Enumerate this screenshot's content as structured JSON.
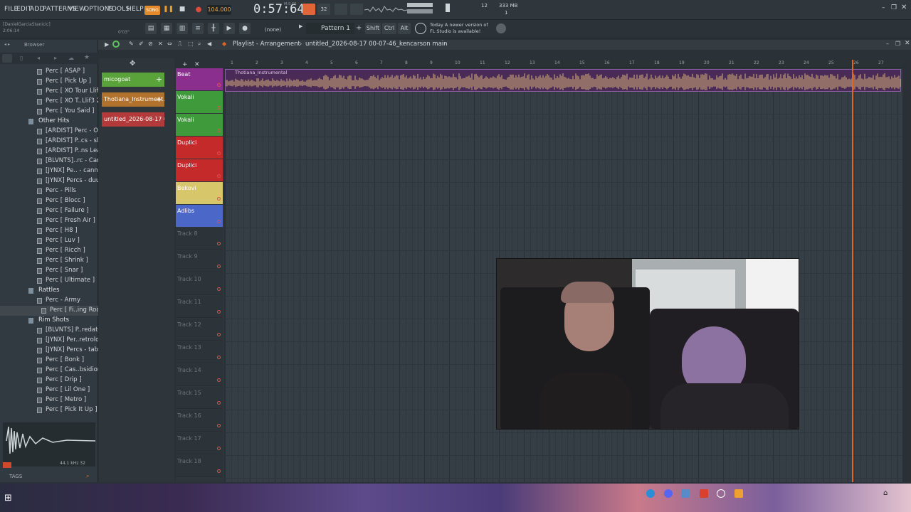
{
  "menu": [
    "FILE",
    "EDIT",
    "ADD",
    "PATTERNS",
    "VIEW",
    "OPTIONS",
    "TOOLS",
    "HELP"
  ],
  "transport": {
    "mode": "SONG",
    "tempo": "104.000",
    "time": "0:57:64",
    "time_label": "M:S:CS",
    "cpu": "12",
    "ram": "333 MB",
    "poly": "1"
  },
  "user": {
    "name": "[DanielGarciaStanicic]",
    "elapsed": "2:06:14",
    "hint": "0'03\""
  },
  "toolbar": {
    "snap": "(none)",
    "pattern": "Pattern 1",
    "shift": "Shift",
    "ctrl": "Ctrl",
    "alt": "Alt",
    "news_line1": "Today  A newer version of",
    "news_line2": "FL Studio is available!"
  },
  "browser": {
    "title": "Browser",
    "items": [
      {
        "label": "Perc [ ASAP ]",
        "folder": false
      },
      {
        "label": "Perc [ Pick Up ]",
        "folder": false
      },
      {
        "label": "Perc [ XO Tour Llif3 ]",
        "folder": false
      },
      {
        "label": "Perc [ XO T..Llif3 2 ]",
        "folder": false
      },
      {
        "label": "Perc [ You Said ]",
        "folder": false
      },
      {
        "label": "Other Hits",
        "folder": true
      },
      {
        "label": "[ARDIST] Perc - OV",
        "folder": false
      },
      {
        "label": "[ARDIST] P..cs - slatt",
        "folder": false
      },
      {
        "label": "[ARDIST] P..ns Lean",
        "folder": false
      },
      {
        "label": "[BLVNTS]..rc - Carti",
        "folder": false
      },
      {
        "label": "[JYNX] Pe.. - cannon",
        "folder": false
      },
      {
        "label": "[JYNX] Percs - duubi",
        "folder": false
      },
      {
        "label": "Perc - Pills",
        "folder": false
      },
      {
        "label": "Perc [ Blocc ]",
        "folder": false
      },
      {
        "label": "Perc [ Failure ]",
        "folder": false
      },
      {
        "label": "Perc [ Fresh Air ]",
        "folder": false
      },
      {
        "label": "Perc [ H8 ]",
        "folder": false
      },
      {
        "label": "Perc [ Luv ]",
        "folder": false
      },
      {
        "label": "Perc [ Ricch ]",
        "folder": false
      },
      {
        "label": "Perc [ Shrink ]",
        "folder": false
      },
      {
        "label": "Perc [ Snar ]",
        "folder": false
      },
      {
        "label": "Perc [ Ultimate ]",
        "folder": false
      },
      {
        "label": "Rattles",
        "folder": true
      },
      {
        "label": "Perc - Army",
        "folder": false
      },
      {
        "label": "Perc [ Fi..ing Rod ]",
        "folder": false,
        "selected": true
      },
      {
        "label": "Rim Shots",
        "folder": true
      },
      {
        "label": "[BLVNTS] P..redator",
        "folder": false
      },
      {
        "label": "[JYNX] Per..retrolog",
        "folder": false
      },
      {
        "label": "[JYNX] Percs - taboo",
        "folder": false
      },
      {
        "label": "Perc [ Bonk ]",
        "folder": false
      },
      {
        "label": "Perc [ Cas..bsidion ]",
        "folder": false
      },
      {
        "label": "Perc [ Drip ]",
        "folder": false
      },
      {
        "label": "Perc [ Lil One ]",
        "folder": false
      },
      {
        "label": "Perc [ Metro ]",
        "folder": false
      },
      {
        "label": "Perc [ Pick It Up ]",
        "folder": false
      }
    ],
    "sample_info": "44.1 kHz 32",
    "tags": "TAGS"
  },
  "playlist": {
    "title": "Playlist - Arrangement",
    "project": "untitled_2026-08-17 00-07-46_kencarson main"
  },
  "patterns": [
    {
      "label": "micogoat",
      "color": "#5aa23a"
    },
    {
      "label": "Thotiana_Instrument..",
      "color": "#b0722c"
    },
    {
      "label": "untitled_2026-08-17 00-..",
      "color": "#b33a3a"
    }
  ],
  "tracks": [
    {
      "label": "Beat",
      "color": "#8b2f8f"
    },
    {
      "label": "Vokali",
      "color": "#3e9a3a"
    },
    {
      "label": "Vokali",
      "color": "#3e9a3a"
    },
    {
      "label": "Duplici",
      "color": "#c42a2a"
    },
    {
      "label": "Duplici",
      "color": "#c42a2a"
    },
    {
      "label": "Bekovi",
      "color": "#d8c66a"
    },
    {
      "label": "Adlibs",
      "color": "#4b68c9"
    },
    {
      "label": "Track 8"
    },
    {
      "label": "Track 9"
    },
    {
      "label": "Track 10"
    },
    {
      "label": "Track 11"
    },
    {
      "label": "Track 12"
    },
    {
      "label": "Track 13"
    },
    {
      "label": "Track 14"
    },
    {
      "label": "Track 15"
    },
    {
      "label": "Track 16"
    },
    {
      "label": "Track 17"
    },
    {
      "label": "Track 18"
    }
  ],
  "ruler": [
    "1",
    "2",
    "3",
    "4",
    "5",
    "6",
    "7",
    "8",
    "9",
    "10",
    "11",
    "12",
    "13",
    "14",
    "15",
    "16",
    "17",
    "18",
    "19",
    "20",
    "21",
    "22",
    "23",
    "24",
    "25",
    "26",
    "27"
  ],
  "clip": {
    "name": "Thotiana_Instrumental"
  },
  "icons": [
    "play-icon",
    "stop-icon",
    "record-icon",
    "pattern-song-toggle-icon",
    "snap-icon",
    "pencil-icon",
    "brush-icon",
    "delete-icon",
    "mute-icon",
    "slice-icon",
    "select-icon",
    "zoom-icon",
    "speaker-icon",
    "windows-start-icon"
  ]
}
